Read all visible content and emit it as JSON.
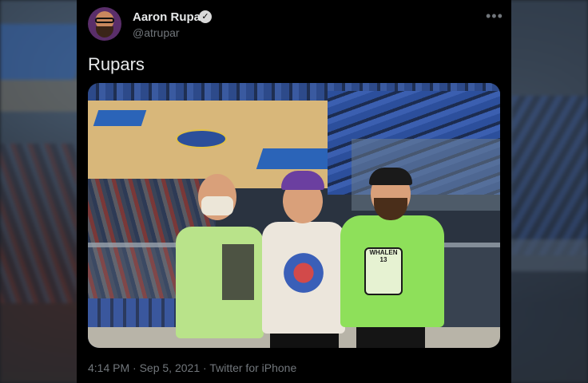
{
  "tweet": {
    "author_name": "Aaron Rupar",
    "author_handle": "@atrupar",
    "verified_icon": "verified-badge-icon",
    "more_icon": "more-options-icon",
    "text": "Rupars",
    "photo_badge_text": "WHALEN 13",
    "time": "4:14 PM",
    "separator": "·",
    "date": "Sep 5, 2021",
    "source": "Twitter for iPhone"
  },
  "colors": {
    "card_bg": "#000000",
    "primary_text": "#e7e9ea",
    "secondary_text": "#71767b"
  }
}
